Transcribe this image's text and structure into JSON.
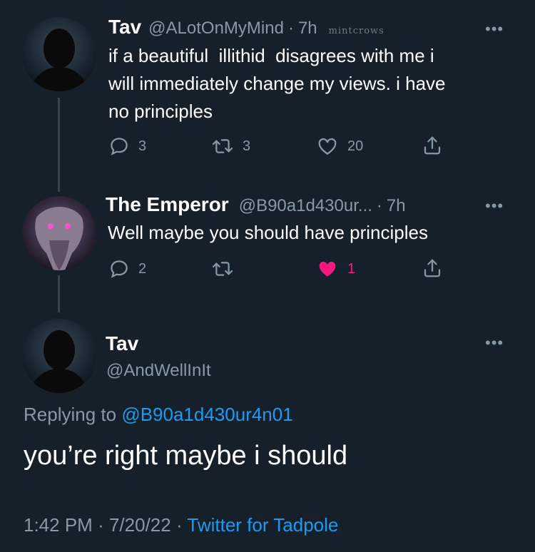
{
  "tweets": [
    {
      "display_name": "Tav",
      "handle": "@ALotOnMyMind",
      "time_sep": "·",
      "time": "7h",
      "watermark": "mintcrows",
      "text_lines": [
        "if a beautiful  illithid  disagrees with me i",
        "will immediately change my views. i have",
        "no principles"
      ],
      "replies": "3",
      "retweets": "3",
      "likes": "20",
      "more": "•••"
    },
    {
      "display_name": "The Emperor",
      "handle": "@B90a1d430ur...",
      "time_sep": "·",
      "time": "7h",
      "text_lines": [
        "Well maybe you should have principles"
      ],
      "replies": "2",
      "retweets": "",
      "likes": "1",
      "liked": true,
      "more": "•••"
    }
  ],
  "main": {
    "display_name": "Tav",
    "handle": "@AndWellInIt",
    "more": "•••",
    "replying_prefix": "Replying to",
    "replying_handle": "@B90a1d430ur4n01",
    "text": "you’re right maybe i should",
    "time": "1:42 PM",
    "date_sep": "·",
    "date": "7/20/22",
    "source_sep": "·",
    "source": "Twitter for Tadpole"
  },
  "colors": {
    "background": "#15202b",
    "secondary_text": "#8899a6",
    "link": "#1d9bf0",
    "like_active": "#f91880",
    "thread_line": "#38444d"
  },
  "icons": [
    "reply-icon",
    "retweet-icon",
    "like-icon",
    "share-icon",
    "more-icon"
  ]
}
